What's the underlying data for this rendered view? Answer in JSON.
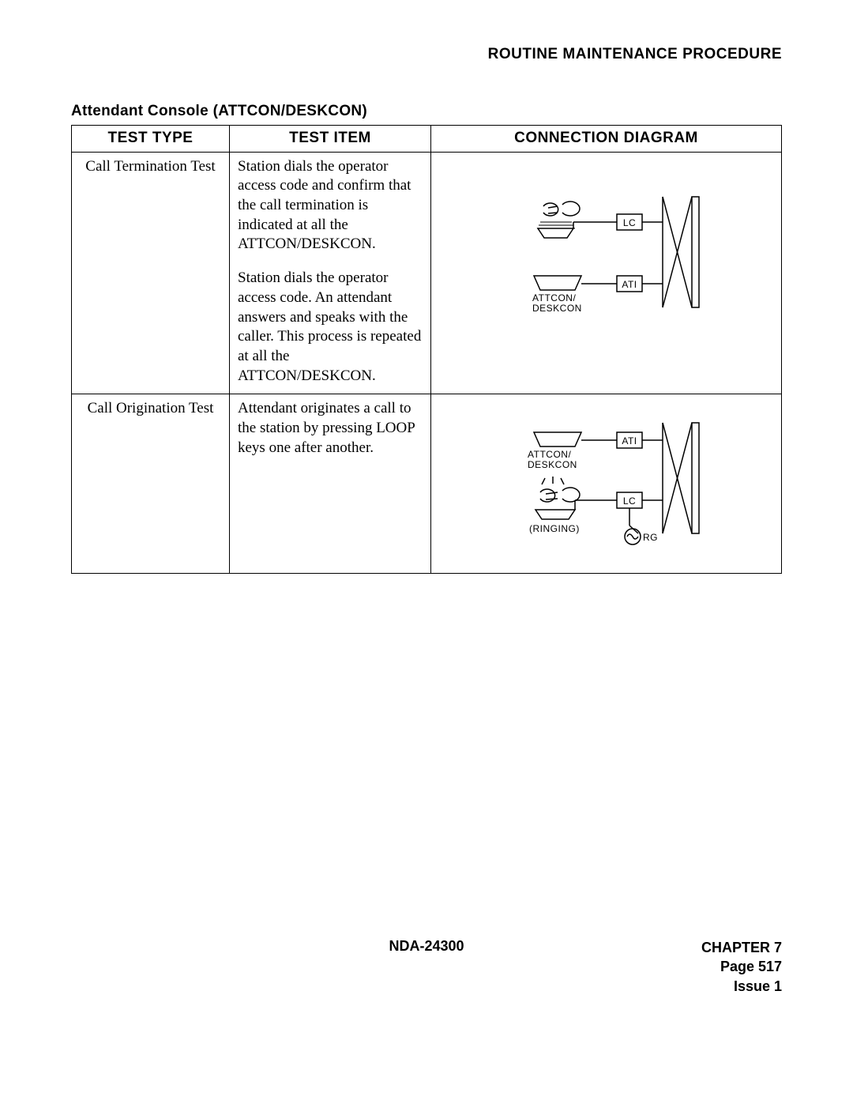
{
  "header": {
    "right": "ROUTINE MAINTENANCE PROCEDURE"
  },
  "section_title": "Attendant Console (ATTCON/DESKCON)",
  "table": {
    "headers": {
      "col1": "TEST TYPE",
      "col2": "TEST ITEM",
      "col3": "CONNECTION DIAGRAM"
    },
    "rows": [
      {
        "test_type": "Call Termination Test",
        "test_item_p1": "Station dials the operator access code and confirm that the call termination is indicated at all the ATTCON/DESKCON.",
        "test_item_p2": "Station dials the operator access code. An attendant answers and speaks with the caller. This process is repeated at all the ATTCON/DESKCON.",
        "diagram": {
          "labels": {
            "lc": "LC",
            "ati": "ATI",
            "attcon1": "ATTCON/",
            "attcon2": "DESKCON"
          }
        }
      },
      {
        "test_type": "Call Origination Test",
        "test_item_p1": "Attendant originates a call to the station by pressing LOOP keys one after another.",
        "diagram": {
          "labels": {
            "lc": "LC",
            "ati": "ATI",
            "attcon1": "ATTCON/",
            "attcon2": "DESKCON",
            "ringing": "(RINGING)",
            "rg": "RG"
          }
        }
      }
    ]
  },
  "footer": {
    "doc": "NDA-24300",
    "chapter": "CHAPTER 7",
    "page": "Page 517",
    "issue": "Issue 1"
  }
}
